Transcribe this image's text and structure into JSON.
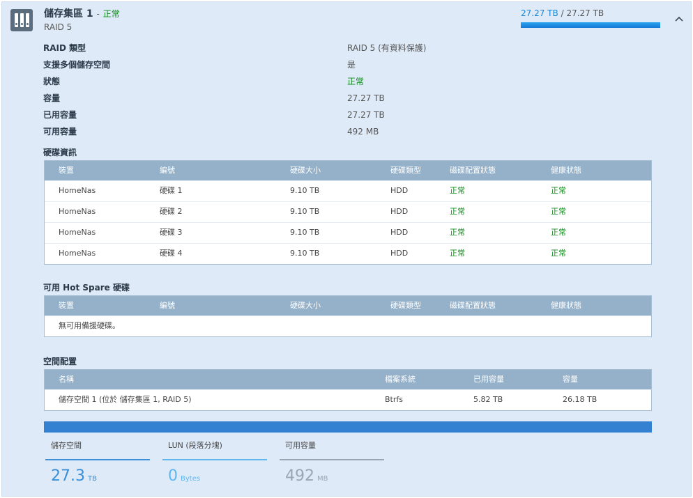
{
  "pool": {
    "title": "儲存集區 1",
    "separator": "-",
    "status": "正常",
    "raid": "RAID 5",
    "usage_used": "27.27 TB",
    "usage_sep": "/",
    "usage_total": "27.27 TB",
    "collapse_icon": "chevron-up-icon"
  },
  "info": [
    {
      "label": "RAID 類型",
      "value": "RAID 5 (有資料保護)"
    },
    {
      "label": "支援多個儲存空間",
      "value": "是"
    },
    {
      "label": "狀態",
      "value": "正常"
    },
    {
      "label": "容量",
      "value": "27.27 TB"
    },
    {
      "label": "已用容量",
      "value": "27.27 TB"
    },
    {
      "label": "可用容量",
      "value": "492 MB"
    }
  ],
  "disks": {
    "title": "硬碟資訊",
    "columns": [
      "裝置",
      "編號",
      "硬碟大小",
      "硬碟類型",
      "磁碟配置狀態",
      "健康狀態"
    ],
    "rows": [
      [
        "HomeNas",
        "硬碟 1",
        "9.10 TB",
        "HDD",
        "正常",
        "正常"
      ],
      [
        "HomeNas",
        "硬碟 2",
        "9.10 TB",
        "HDD",
        "正常",
        "正常"
      ],
      [
        "HomeNas",
        "硬碟 3",
        "9.10 TB",
        "HDD",
        "正常",
        "正常"
      ],
      [
        "HomeNas",
        "硬碟 4",
        "9.10 TB",
        "HDD",
        "正常",
        "正常"
      ]
    ]
  },
  "hotspare": {
    "title": "可用 Hot Spare 硬碟",
    "columns": [
      "裝置",
      "編號",
      "硬碟大小",
      "硬碟類型",
      "磁碟配置狀態",
      "健康狀態"
    ],
    "empty": "無可用備援硬碟。"
  },
  "space": {
    "title": "空間配置",
    "columns": [
      "名稱",
      "檔案系統",
      "已用容量",
      "容量"
    ],
    "rows": [
      [
        "儲存空間 1 (位於 儲存集區 1, RAID 5)",
        "Btrfs",
        "5.82 TB",
        "26.18 TB"
      ]
    ]
  },
  "stats": [
    {
      "label": "儲存空間",
      "value": "27.3",
      "unit": "TB",
      "color": "#3a8fd6"
    },
    {
      "label": "LUN (段落分塊)",
      "value": "0",
      "unit": "Bytes",
      "color": "#5fb7ef"
    },
    {
      "label": "可用容量",
      "value": "492",
      "unit": "MB",
      "color": "#9aa6b2"
    }
  ],
  "colors": {
    "ok": "#0f8a1a",
    "accent": "#1a86d4",
    "table_header": "#94b1c9",
    "bar": "#3481d1"
  }
}
